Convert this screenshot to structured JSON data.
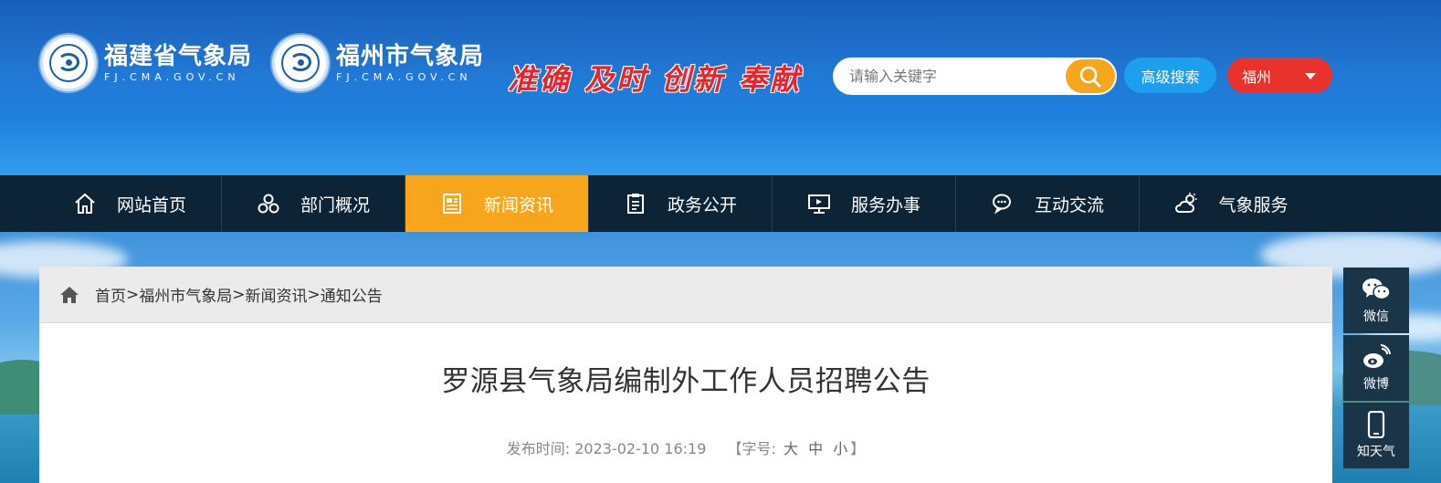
{
  "header": {
    "logo1": {
      "name": "福建省气象局",
      "domain": "FJ.CMA.GOV.CN"
    },
    "logo2": {
      "name": "福州市气象局",
      "domain": "FJ.CMA.GOV.CN"
    },
    "slogan": "准确 及时 创新 奉献",
    "search": {
      "placeholder": "请输入关键字",
      "value": ""
    },
    "advanced_search_label": "高级搜索",
    "city_select": "福州"
  },
  "nav": {
    "items": [
      {
        "label": "网站首页",
        "icon": "home-icon"
      },
      {
        "label": "部门概况",
        "icon": "department-icon"
      },
      {
        "label": "新闻资讯",
        "icon": "news-icon",
        "active": true
      },
      {
        "label": "政务公开",
        "icon": "clipboard-icon"
      },
      {
        "label": "服务办事",
        "icon": "monitor-icon"
      },
      {
        "label": "互动交流",
        "icon": "chat-icon"
      },
      {
        "label": "气象服务",
        "icon": "weather-icon"
      }
    ]
  },
  "breadcrumb": {
    "items": [
      "首页",
      "福州市气象局",
      "新闻资讯",
      "通知公告"
    ],
    "separator": ">"
  },
  "article": {
    "title": "罗源县气象局编制外工作人员招聘公告",
    "publish_label": "发布时间: ",
    "publish_time": "2023-02-10 16:19",
    "font_size_label": "【字号:",
    "font_sizes": [
      "大",
      "中",
      "小"
    ],
    "font_size_close": "】"
  },
  "sidebar": {
    "items": [
      {
        "label": "微信",
        "icon": "wechat-icon"
      },
      {
        "label": "微博",
        "icon": "weibo-icon"
      },
      {
        "label": "知天气",
        "icon": "phone-icon"
      }
    ]
  },
  "colors": {
    "nav_bg": "#0d2436",
    "nav_active": "#f6a51c",
    "search_button": "#f6a51c",
    "advanced_search": "#1d9ff0",
    "city_select": "#e8322b",
    "slogan": "#e8242c",
    "sidebar_bg": "#1a3448"
  }
}
